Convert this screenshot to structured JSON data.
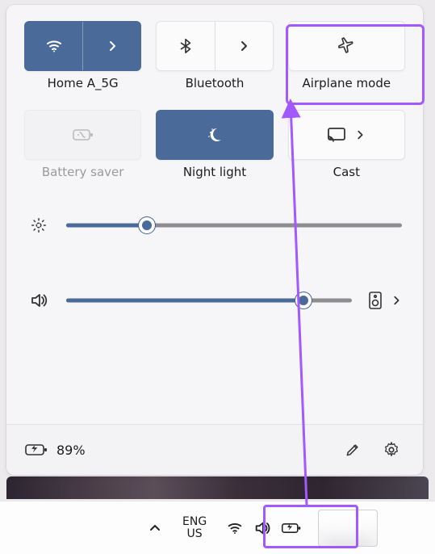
{
  "tiles": {
    "wifi": {
      "label": "Home A_5G",
      "state": "on",
      "has_expand": true
    },
    "bluetooth": {
      "label": "Bluetooth",
      "state": "off",
      "has_expand": true
    },
    "airplane": {
      "label": "Airplane mode",
      "state": "off"
    },
    "battery_saver": {
      "label": "Battery saver",
      "state": "disabled"
    },
    "night_light": {
      "label": "Night light",
      "state": "on"
    },
    "cast": {
      "label": "Cast",
      "state": "off",
      "has_expand": true
    }
  },
  "sliders": {
    "brightness": {
      "percent": 24
    },
    "volume": {
      "percent": 83
    }
  },
  "footer": {
    "battery_text": "89%"
  },
  "taskbar": {
    "language_line1": "ENG",
    "language_line2": "US"
  },
  "annotation": {
    "highlight_airplane_tile": true,
    "highlight_systray": true,
    "arrow_from_systray_to_airplane": true
  }
}
